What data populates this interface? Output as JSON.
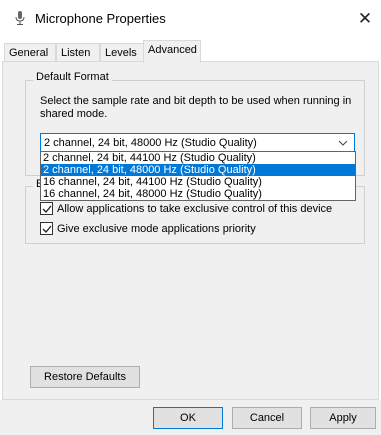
{
  "window": {
    "title": "Microphone Properties",
    "close_glyph": "✕"
  },
  "tabs": [
    {
      "label": "General"
    },
    {
      "label": "Listen"
    },
    {
      "label": "Levels"
    },
    {
      "label": "Advanced"
    }
  ],
  "active_tab": "Advanced",
  "default_format": {
    "group_label": "Default Format",
    "description": "Select the sample rate and bit depth to be used when running in shared mode.",
    "selected": "2 channel, 24 bit, 48000 Hz (Studio Quality)",
    "options": [
      "2 channel, 24 bit, 44100 Hz (Studio Quality)",
      "2 channel, 24 bit, 48000 Hz (Studio Quality)",
      "16 channel, 24 bit, 44100 Hz (Studio Quality)",
      "16 channel, 24 bit, 48000 Hz (Studio Quality)"
    ]
  },
  "exclusive_mode": {
    "group_label": "E",
    "allow_exclusive": {
      "label": "Allow applications to take exclusive control of this device",
      "checked": true
    },
    "give_priority": {
      "label": "Give exclusive mode applications priority",
      "checked": true
    }
  },
  "buttons": {
    "restore": "Restore Defaults",
    "ok": "OK",
    "cancel": "Cancel",
    "apply": "Apply"
  },
  "colors": {
    "accent": "#0078d7",
    "panel": "#f0f0f0"
  },
  "icons": {
    "title": "microphone-icon",
    "dropdown": "chevron-down-icon",
    "check": "checkmark-icon"
  }
}
